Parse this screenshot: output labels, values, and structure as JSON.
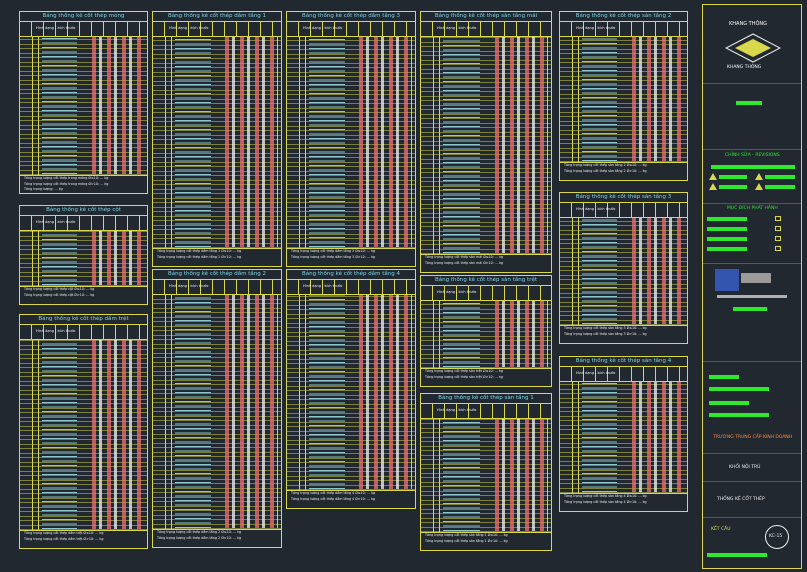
{
  "tables": [
    {
      "id": "t1",
      "title": "Bảng thống kê cốt thép móng",
      "hdr": "Hình dạng - kích thước",
      "sum": [
        "Tổng trọng lượng cốt thép trong móng Ø≤10: ... kg",
        "Tổng trọng lượng cốt thép trong móng Ø>10: ... kg",
        "Tổng trọng lượng: ... kg"
      ]
    },
    {
      "id": "t2",
      "title": "Bảng thống kê cốt thép dầm tầng 1",
      "hdr": "Hình dạng - kích thước",
      "sum": [
        "Tổng trọng lượng cốt thép dầm tầng 1 Ø≤10: ... kg",
        "Tổng trọng lượng cốt thép dầm tầng 1 Ø>10: ... kg"
      ]
    },
    {
      "id": "t3",
      "title": "Bảng thống kê cốt thép dầm tầng 3",
      "hdr": "Hình dạng - kích thước",
      "sum": [
        "Tổng trọng lượng cốt thép dầm tầng 3 Ø≤10: ... kg",
        "Tổng trọng lượng cốt thép dầm tầng 3 Ø>10: ... kg"
      ]
    },
    {
      "id": "t4",
      "title": "Bảng thống kê cốt thép sàn tầng mái",
      "hdr": "Hình dạng - kích thước",
      "sum": [
        "Tổng trọng lượng cốt thép sàn mái Ø≤10: ... kg",
        "Tổng trọng lượng cốt thép sàn mái Ø>10: ... kg"
      ]
    },
    {
      "id": "t5",
      "title": "Bảng thống kê cốt thép sàn tầng 2",
      "hdr": "Hình dạng - kích thước",
      "sum": [
        "Tổng trọng lượng cốt thép sàn tầng 2 Ø≤10: ... kg",
        "Tổng trọng lượng cốt thép sàn tầng 2 Ø>10: ... kg"
      ]
    },
    {
      "id": "t6",
      "title": "Bảng thống kê cốt thép cột",
      "hdr": "Hình dạng - kích thước",
      "sum": [
        "Tổng trọng lượng cốt thép cột Ø≤10: ... kg",
        "Tổng trọng lượng cốt thép cột Ø>10: ... kg"
      ]
    },
    {
      "id": "t7",
      "title": "Bảng thống kê cốt thép sàn tầng 3",
      "hdr": "Hình dạng - kích thước",
      "sum": [
        "Tổng trọng lượng cốt thép sàn tầng 3 Ø≤10: ... kg",
        "Tổng trọng lượng cốt thép sàn tầng 3 Ø>10: ... kg"
      ]
    },
    {
      "id": "t8",
      "title": "Bảng thống kê cốt thép dầm tầng 2",
      "hdr": "Hình dạng - kích thước",
      "sum": [
        "Tổng trọng lượng cốt thép dầm tầng 2 Ø≤10: ... kg",
        "Tổng trọng lượng cốt thép dầm tầng 2 Ø>10: ... kg"
      ]
    },
    {
      "id": "t9",
      "title": "Bảng thống kê cốt thép dầm tầng 4",
      "hdr": "Hình dạng - kích thước",
      "sum": [
        "Tổng trọng lượng cốt thép dầm tầng 4 Ø≤10: ... kg",
        "Tổng trọng lượng cốt thép dầm tầng 4 Ø>10: ... kg"
      ]
    },
    {
      "id": "t10",
      "title": "Bảng thống kê cốt thép sàn tầng trệt",
      "hdr": "Hình dạng - kích thước",
      "sum": [
        "Tổng trọng lượng cốt thép sàn trệt Ø≤10: ... kg",
        "Tổng trọng lượng cốt thép sàn trệt Ø>10: ... kg"
      ]
    },
    {
      "id": "t11",
      "title": "Bảng thống kê cốt thép dầm trệt",
      "hdr": "Hình dạng - kích thước",
      "sum": [
        "Tổng trọng lượng cốt thép dầm trệt Ø≤10: ... kg",
        "Tổng trọng lượng cốt thép dầm trệt Ø>10: ... kg"
      ]
    },
    {
      "id": "t12",
      "title": "Bảng thống kê cốt thép sàn tầng 1",
      "hdr": "Hình dạng - kích thước",
      "sum": [
        "Tổng trọng lượng cốt thép sàn tầng 1 Ø≤10: ... kg",
        "Tổng trọng lượng cốt thép sàn tầng 1 Ø>10: ... kg"
      ]
    },
    {
      "id": "t13",
      "title": "Bảng thống kê cốt thép sàn tầng 4",
      "hdr": "Hình dạng - kích thước",
      "sum": [
        "Tổng trọng lượng cốt thép sàn tầng 4 Ø≤10: ... kg",
        "Tổng trọng lượng cốt thép sàn tầng 4 Ø>10: ... kg"
      ]
    }
  ],
  "title_block": {
    "company": "KHANG THÔNG",
    "logo_text": "KHANG THÔNG",
    "revision_label": "CHỈNH SỬA - REVISIONS",
    "purpose_label": "MỤC ĐÍCH PHÁT HÀNH",
    "project_label": "TRƯỜNG TRUNG CẤP KINH DOANH",
    "client_label": "KHỐI NỘI TRÚ",
    "sheet_title": "THỐNG KÊ CỐT THÉP",
    "discipline": "KẾT CẤU",
    "sheet_no": "KC-15"
  },
  "colors": {
    "background": "#212830",
    "frame": "#d8d84a",
    "accent_green": "#2ee82e",
    "accent_red": "#c62828",
    "text_cyan": "#7fd6e6"
  }
}
